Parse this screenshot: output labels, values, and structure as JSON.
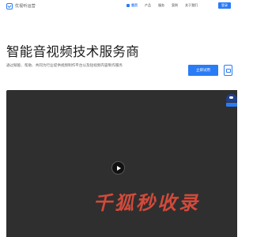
{
  "header": {
    "logo_text": "优视听运营",
    "nav": [
      {
        "label": "首页",
        "active": true
      },
      {
        "label": "产品",
        "active": false
      },
      {
        "label": "服务",
        "active": false
      },
      {
        "label": "案例",
        "active": false
      },
      {
        "label": "关于我们",
        "active": false
      }
    ],
    "login_label": "登录"
  },
  "hero": {
    "title": "智能音视频技术服务商",
    "description": "通过赋能、帮助、共同为行业提供视频制作平台以及短视频内容制作服务",
    "cta_label": "立即试用"
  },
  "video": {
    "watermark": "千狐秒收录"
  },
  "colors": {
    "accent": "#2a7bf6",
    "video_bg": "#2f2f2f",
    "watermark": "#d24a3b"
  },
  "icons": [
    "logo-icon",
    "home-icon",
    "monitor-icon",
    "play-icon",
    "badge-icon"
  ]
}
